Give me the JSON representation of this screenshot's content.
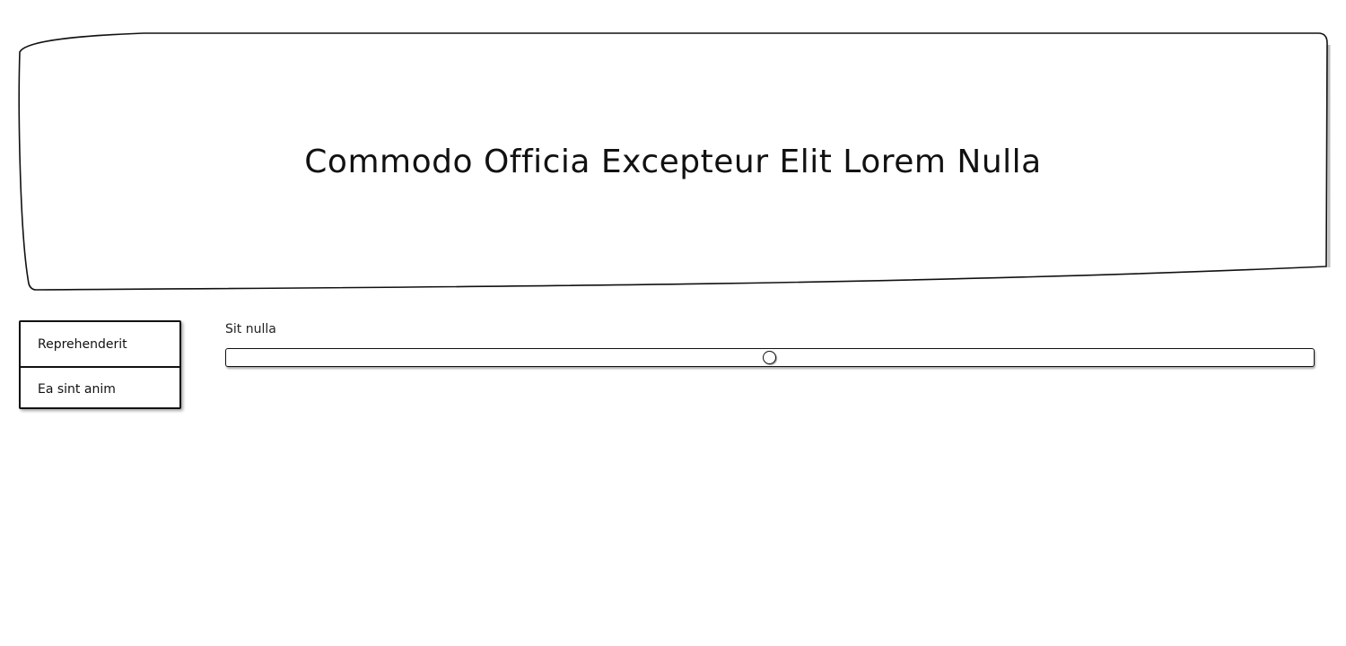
{
  "header": {
    "title": "Commodo Officia Excepteur Elit Lorem Nulla"
  },
  "menu": {
    "items": [
      {
        "label": "Reprehenderit"
      },
      {
        "label": "Ea sint anim"
      }
    ]
  },
  "slider": {
    "label": "Sit nulla",
    "value_fraction": 0.5
  }
}
